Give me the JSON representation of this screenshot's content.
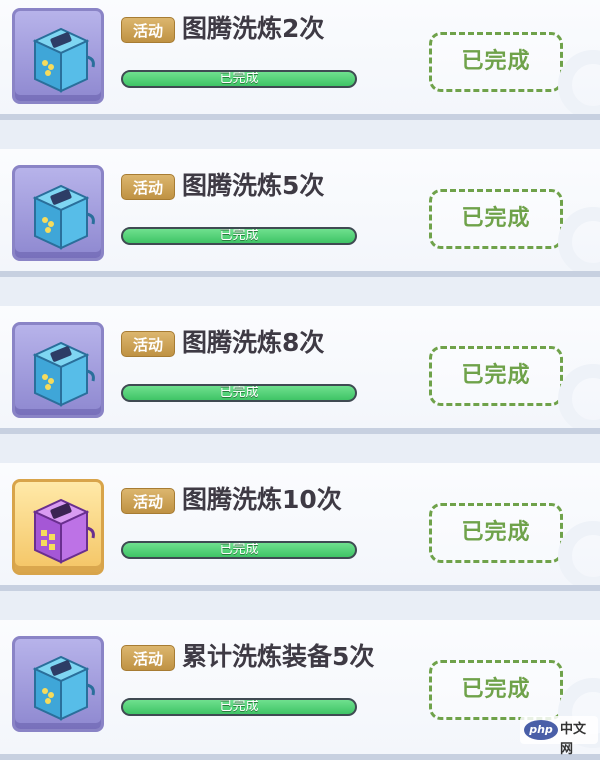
{
  "quests": [
    {
      "tag": "活动",
      "title": "图腾洗炼2次",
      "progress_label": "已完成",
      "progress": 1.0,
      "button_label": "已完成",
      "reward_icon": "blue-chest-icon"
    },
    {
      "tag": "活动",
      "title": "图腾洗炼5次",
      "progress_label": "已完成",
      "progress": 1.0,
      "button_label": "已完成",
      "reward_icon": "blue-chest-icon"
    },
    {
      "tag": "活动",
      "title": "图腾洗炼8次",
      "progress_label": "已完成",
      "progress": 1.0,
      "button_label": "已完成",
      "reward_icon": "blue-chest-icon"
    },
    {
      "tag": "活动",
      "title": "图腾洗炼10次",
      "progress_label": "已完成",
      "progress": 1.0,
      "button_label": "已完成",
      "reward_icon": "purple-chest-icon"
    },
    {
      "tag": "活动",
      "title": "累计洗炼装备5次",
      "progress_label": "已完成",
      "progress": 1.0,
      "button_label": "已完成",
      "reward_icon": "blue-chest-icon"
    }
  ],
  "colors": {
    "progress_fill": "#3fc466",
    "done_button": "#6fa24a",
    "tag": "#c99a4a"
  },
  "watermark": {
    "logo": "php",
    "text": "中文网"
  }
}
